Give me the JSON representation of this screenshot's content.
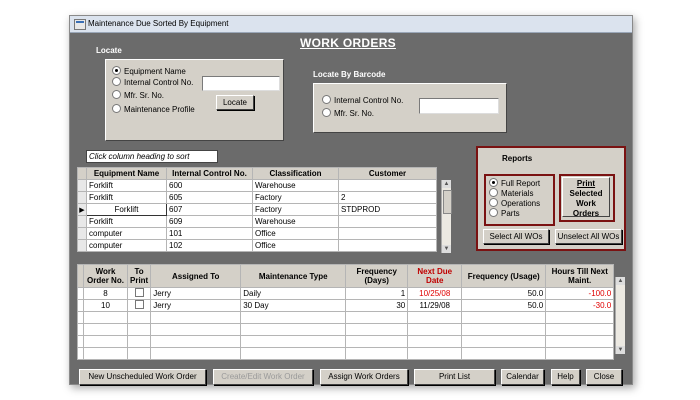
{
  "window": {
    "title": "Maintenance Due Sorted By Equipment"
  },
  "heading": "WORK ORDERS",
  "locate": {
    "label": "Locate",
    "options": [
      "Equipment Name",
      "Internal Control No.",
      "Mfr. Sr. No.",
      "Maintenance Profile"
    ],
    "selected": "Equipment Name",
    "input_value": "",
    "button": "Locate"
  },
  "barcode": {
    "label": "Locate By Barcode",
    "options": [
      "Internal Control No.",
      "Mfr. Sr. No."
    ],
    "input_value": ""
  },
  "hint": "Click column heading to sort",
  "equipment_table": {
    "columns": [
      "Equipment Name",
      "Internal Control No.",
      "Classification",
      "Customer"
    ],
    "rows": [
      [
        "Forklift",
        "600",
        "Warehouse",
        ""
      ],
      [
        "Forklift",
        "605",
        "Factory",
        "2"
      ],
      [
        "Forklift",
        "607",
        "Factory",
        "STDPROD"
      ],
      [
        "Forklift",
        "609",
        "Warehouse",
        ""
      ],
      [
        "computer",
        "101",
        "Office",
        ""
      ],
      [
        "computer",
        "102",
        "Office",
        ""
      ]
    ],
    "current_row_marker": "▶"
  },
  "reports": {
    "title": "Reports",
    "options": [
      "Full Report",
      "Materials",
      "Operations",
      "Parts"
    ],
    "selected": "Full Report",
    "print_button": [
      "Print",
      "Selected",
      "Work Orders"
    ],
    "select_all": "Select All WOs",
    "unselect_all": "Unselect All WOs"
  },
  "work_orders": {
    "columns": [
      "Work Order No.",
      "To Print",
      "Assigned To",
      "Maintenance Type",
      "Frequency (Days)",
      "Next Due Date",
      "Frequency (Usage)",
      "Hours Till Next Maint."
    ],
    "rows": [
      {
        "no": "8",
        "assigned": "Jerry",
        "type": "Daily",
        "freq_days": "1",
        "due": "10/25/08",
        "freq_usage": "50.0",
        "hours": "-100.0"
      },
      {
        "no": "10",
        "assigned": "Jerry",
        "type": "30 Day",
        "freq_days": "30",
        "due": "11/29/08",
        "freq_usage": "50.0",
        "hours": "-30.0"
      }
    ]
  },
  "buttons": {
    "new_unscheduled": "New Unscheduled Work Order",
    "create_edit": "Create/Edit Work Order",
    "assign": "Assign Work Orders",
    "print_list": "Print List",
    "calendar": "Calendar",
    "help": "Help",
    "close": "Close"
  },
  "colors": {
    "background": "#6b6b6b",
    "panel": "#d4d0c8",
    "report_border": "#7a1212",
    "negative": "#e00000"
  }
}
